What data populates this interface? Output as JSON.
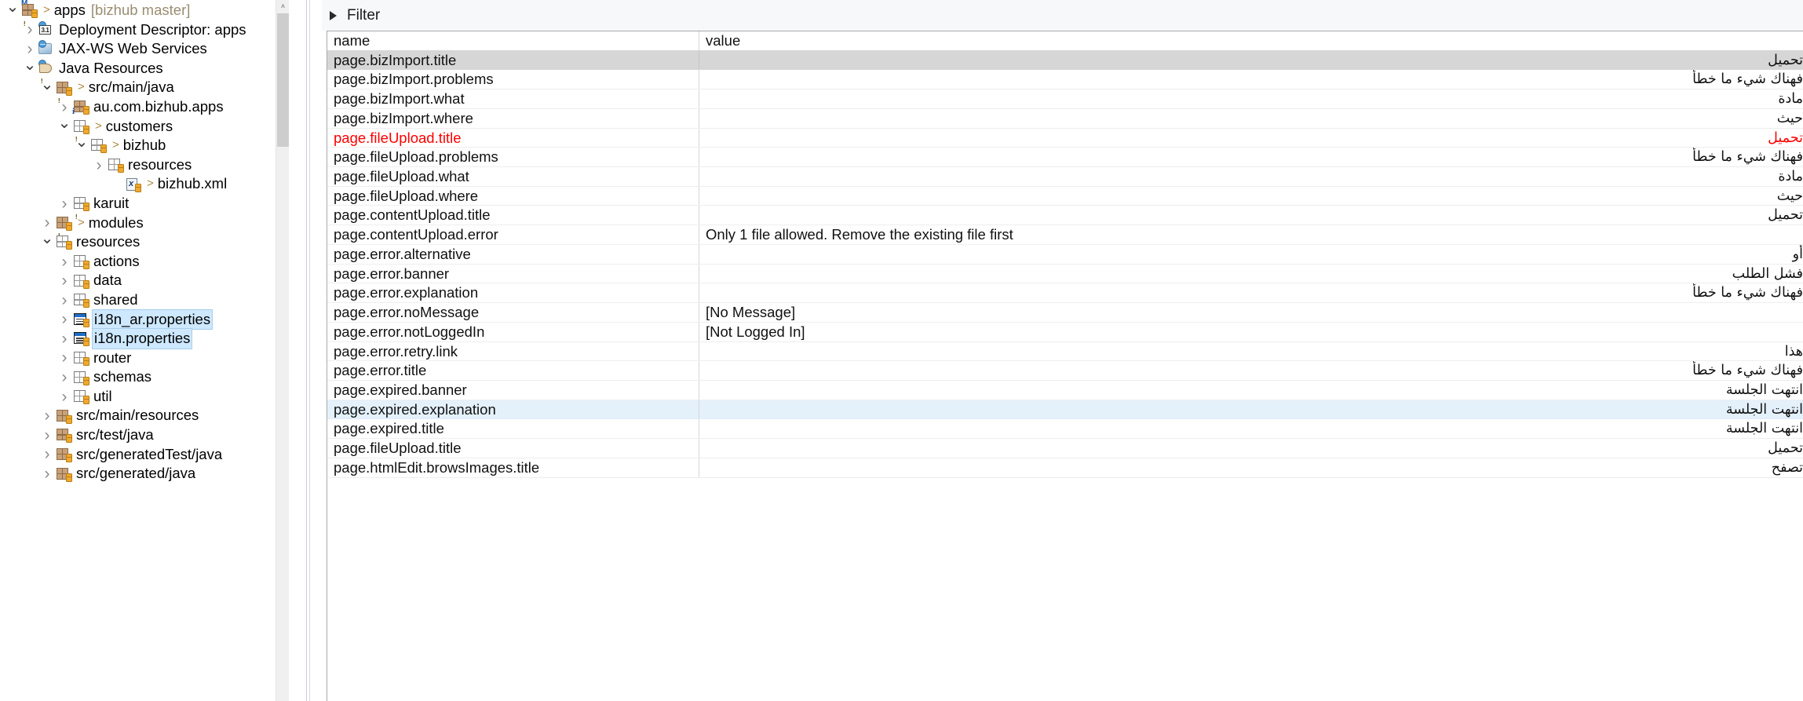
{
  "explorer": {
    "scrollbar": {
      "up_arrow": "˄"
    },
    "tree": [
      {
        "id": "apps",
        "indent": 0,
        "twisty": "open",
        "icon": "project-maven-warning-icon",
        "arrow": true,
        "label": "apps",
        "suffix": "[bizhub master]"
      },
      {
        "id": "deployment-descriptor",
        "indent": 1,
        "twisty": "closed",
        "icon": "deployment-descriptor-icon",
        "arrow": false,
        "label": "Deployment Descriptor: apps",
        "suffix": ""
      },
      {
        "id": "jax-ws-web-services",
        "indent": 1,
        "twisty": "closed",
        "icon": "jax-ws-icon",
        "arrow": false,
        "label": "JAX-WS Web Services",
        "suffix": ""
      },
      {
        "id": "java-resources",
        "indent": 1,
        "twisty": "open",
        "icon": "java-resources-icon",
        "arrow": false,
        "label": "Java Resources",
        "suffix": ""
      },
      {
        "id": "src-main-java",
        "indent": 2,
        "twisty": "open",
        "icon": "source-folder-warning-icon",
        "arrow": true,
        "label": "src/main/java",
        "suffix": ""
      },
      {
        "id": "au-com-bizhub-apps",
        "indent": 3,
        "twisty": "closed",
        "icon": "package-info-icon",
        "arrow": false,
        "label": "au.com.bizhub.apps",
        "suffix": ""
      },
      {
        "id": "customers",
        "indent": 3,
        "twisty": "open",
        "icon": "package-warning-icon",
        "arrow": true,
        "label": "customers",
        "suffix": ""
      },
      {
        "id": "bizhub",
        "indent": 4,
        "twisty": "open",
        "icon": "package-icon",
        "arrow": true,
        "label": "bizhub",
        "suffix": ""
      },
      {
        "id": "resources-inner",
        "indent": 5,
        "twisty": "closed",
        "icon": "package-icon",
        "arrow": false,
        "label": "resources",
        "suffix": ""
      },
      {
        "id": "bizhub-xml",
        "indent": 6,
        "twisty": "none",
        "icon": "xml-file-icon",
        "arrow": true,
        "label": "bizhub.xml",
        "suffix": ""
      },
      {
        "id": "karuit",
        "indent": 3,
        "twisty": "closed",
        "icon": "package-warning-icon",
        "arrow": false,
        "label": "karuit",
        "suffix": ""
      },
      {
        "id": "modules",
        "indent": 2,
        "twisty": "closed",
        "icon": "package-warning-brown-icon",
        "arrow": true,
        "label": "modules",
        "suffix": ""
      },
      {
        "id": "resources",
        "indent": 2,
        "twisty": "open",
        "icon": "package-icon",
        "arrow": false,
        "label": "resources",
        "suffix": ""
      },
      {
        "id": "actions",
        "indent": 3,
        "twisty": "closed",
        "icon": "package-icon",
        "arrow": false,
        "label": "actions",
        "suffix": ""
      },
      {
        "id": "data",
        "indent": 3,
        "twisty": "closed",
        "icon": "package-icon",
        "arrow": false,
        "label": "data",
        "suffix": ""
      },
      {
        "id": "shared",
        "indent": 3,
        "twisty": "closed",
        "icon": "package-icon",
        "arrow": false,
        "label": "shared",
        "suffix": ""
      },
      {
        "id": "i18n-ar-properties",
        "indent": 3,
        "twisty": "closed",
        "icon": "properties-file-icon",
        "arrow": false,
        "label": "i18n_ar.properties",
        "suffix": "",
        "selected": true
      },
      {
        "id": "i18n-properties",
        "indent": 3,
        "twisty": "closed",
        "icon": "properties-file-icon",
        "arrow": false,
        "label": "i18n.properties",
        "suffix": "",
        "selected": true
      },
      {
        "id": "router",
        "indent": 3,
        "twisty": "closed",
        "icon": "package-icon",
        "arrow": false,
        "label": "router",
        "suffix": ""
      },
      {
        "id": "schemas",
        "indent": 3,
        "twisty": "closed",
        "icon": "package-icon",
        "arrow": false,
        "label": "schemas",
        "suffix": ""
      },
      {
        "id": "util",
        "indent": 3,
        "twisty": "closed",
        "icon": "package-icon",
        "arrow": false,
        "label": "util",
        "suffix": ""
      },
      {
        "id": "src-main-resources",
        "indent": 2,
        "twisty": "closed",
        "icon": "source-folder-icon",
        "arrow": false,
        "label": "src/main/resources",
        "suffix": ""
      },
      {
        "id": "src-test-java",
        "indent": 2,
        "twisty": "closed",
        "icon": "source-folder-icon",
        "arrow": false,
        "label": "src/test/java",
        "suffix": ""
      },
      {
        "id": "src-generatedtest-java",
        "indent": 2,
        "twisty": "closed",
        "icon": "source-folder-icon",
        "arrow": false,
        "label": "src/generatedTest/java",
        "suffix": ""
      },
      {
        "id": "src-generated-java",
        "indent": 2,
        "twisty": "closed",
        "icon": "source-folder-icon",
        "arrow": false,
        "label": "src/generated/java",
        "suffix": ""
      }
    ]
  },
  "editor": {
    "filter": {
      "label": "Filter",
      "expanded": false
    },
    "columns": {
      "name": "name",
      "value": "value"
    },
    "rows": [
      {
        "name": "page.bizImport.title",
        "value": "تحميل",
        "rtl": true,
        "state": "selected-gray"
      },
      {
        "name": "page.bizImport.problems",
        "value": "فهناك شيء ما خطأ",
        "rtl": true,
        "state": "normal"
      },
      {
        "name": "page.bizImport.what",
        "value": "مادة",
        "rtl": true,
        "state": "normal"
      },
      {
        "name": "page.bizImport.where",
        "value": "حيث",
        "rtl": true,
        "state": "normal"
      },
      {
        "name": "page.fileUpload.title",
        "value": "تحميل",
        "rtl": true,
        "state": "error-red"
      },
      {
        "name": "page.fileUpload.problems",
        "value": "فهناك شيء ما خطأ",
        "rtl": true,
        "state": "normal"
      },
      {
        "name": "page.fileUpload.what",
        "value": "مادة",
        "rtl": true,
        "state": "normal"
      },
      {
        "name": "page.fileUpload.where",
        "value": "حيث",
        "rtl": true,
        "state": "normal"
      },
      {
        "name": "page.contentUpload.title",
        "value": "تحميل",
        "rtl": true,
        "state": "normal"
      },
      {
        "name": "page.contentUpload.error",
        "value": "Only 1 file allowed.  Remove the existing file first",
        "rtl": false,
        "state": "normal"
      },
      {
        "name": "page.error.alternative",
        "value": "أو",
        "rtl": true,
        "state": "normal"
      },
      {
        "name": "page.error.banner",
        "value": "فشل الطلب",
        "rtl": true,
        "state": "normal"
      },
      {
        "name": "page.error.explanation",
        "value": "فهناك شيء ما خطأ",
        "rtl": true,
        "state": "normal"
      },
      {
        "name": "page.error.noMessage",
        "value": "[No Message]",
        "rtl": false,
        "state": "normal"
      },
      {
        "name": "page.error.notLoggedIn",
        "value": "[Not Logged In]",
        "rtl": false,
        "state": "normal"
      },
      {
        "name": "page.error.retry.link",
        "value": "هذا",
        "rtl": true,
        "state": "normal"
      },
      {
        "name": "page.error.title",
        "value": "فهناك شيء ما خطأ",
        "rtl": true,
        "state": "normal"
      },
      {
        "name": "page.expired.banner",
        "value": "انتهت الجلسة",
        "rtl": true,
        "state": "normal"
      },
      {
        "name": "page.expired.explanation",
        "value": "انتهت الجلسة",
        "rtl": true,
        "state": "selected-blue"
      },
      {
        "name": "page.expired.title",
        "value": "انتهت الجلسة",
        "rtl": true,
        "state": "normal"
      },
      {
        "name": "page.fileUpload.title",
        "value": "تحميل",
        "rtl": true,
        "state": "normal"
      },
      {
        "name": "page.htmlEdit.browsImages.title",
        "value": "تصفح",
        "rtl": true,
        "state": "normal"
      }
    ]
  },
  "colors": {
    "error_red": "#ff0000",
    "selection_gray": "#d6d6d6",
    "selection_blue": "#e4f1fb",
    "tree_selection_blue": "#cde8ff",
    "filter_bar_bg": "#f7f8fa"
  }
}
